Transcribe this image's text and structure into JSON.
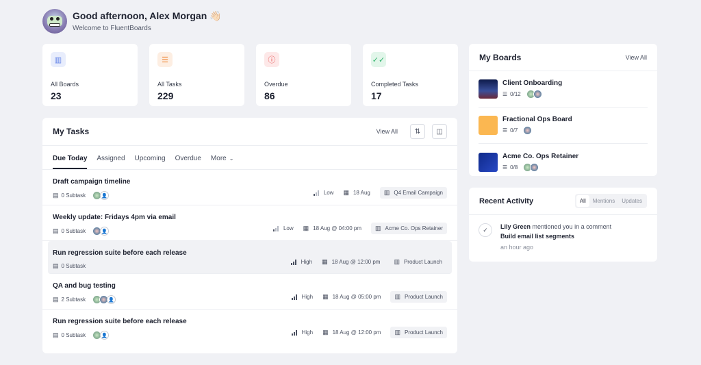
{
  "header": {
    "greeting": "Good afternoon, Alex Morgan 👋🏻",
    "subtitle": "Welcome to FluentBoards"
  },
  "stats": [
    {
      "icon": "boards-icon",
      "label": "All Boards",
      "value": "23",
      "color": "#5b7de6",
      "bg": "#e8edfc"
    },
    {
      "icon": "tasks-list-icon",
      "label": "All Tasks",
      "value": "229",
      "color": "#ef8a3c",
      "bg": "#fdeee2"
    },
    {
      "icon": "alert-circle-icon",
      "label": "Overdue",
      "value": "86",
      "color": "#e54848",
      "bg": "#fde8e8"
    },
    {
      "icon": "double-check-icon",
      "label": "Completed Tasks",
      "value": "17",
      "color": "#2fb36b",
      "bg": "#e2f6ea"
    }
  ],
  "my_tasks": {
    "title": "My Tasks",
    "view_all": "View All",
    "tabs": [
      "Due Today",
      "Assigned",
      "Upcoming",
      "Overdue",
      "More"
    ],
    "rows": [
      {
        "title": "Draft campaign timeline",
        "subtask": "0 Subtask",
        "priority": "Low",
        "due": "18 Aug",
        "board": "Q4 Email Campaign"
      },
      {
        "title": "Weekly update: Fridays 4pm via email",
        "subtask": "0 Subtask",
        "priority": "Low",
        "due": "18 Aug @ 04:00 pm",
        "board": "Acme Co. Ops Retainer"
      },
      {
        "title": "Run regression suite before each release",
        "subtask": "0 Subtask",
        "priority": "High",
        "due": "18 Aug @ 12:00 pm",
        "board": "Product Launch"
      },
      {
        "title": "QA and bug testing",
        "subtask": "2 Subtask",
        "priority": "High",
        "due": "18 Aug @ 05:00 pm",
        "board": "Product Launch"
      },
      {
        "title": "Run regression suite before each release",
        "subtask": "0 Subtask",
        "priority": "High",
        "due": "18 Aug @ 12:00 pm",
        "board": "Product Launch"
      }
    ]
  },
  "my_boards": {
    "title": "My Boards",
    "view_all": "View All",
    "items": [
      {
        "name": "Client Onboarding",
        "count": "0/12",
        "thumb": "#1d2a6b"
      },
      {
        "name": "Fractional Ops Board",
        "count": "0/7",
        "thumb": "#fbb751"
      },
      {
        "name": "Acme Co. Ops Retainer",
        "count": "0/8",
        "thumb": "#1a3aa8"
      }
    ]
  },
  "recent_activity": {
    "title": "Recent Activity",
    "filters": [
      "All",
      "Mentions",
      "Updates"
    ],
    "item": {
      "actor": "Lily Green",
      "action": "mentioned you in a comment",
      "target": "Build email list segments",
      "time": "an hour ago"
    }
  }
}
